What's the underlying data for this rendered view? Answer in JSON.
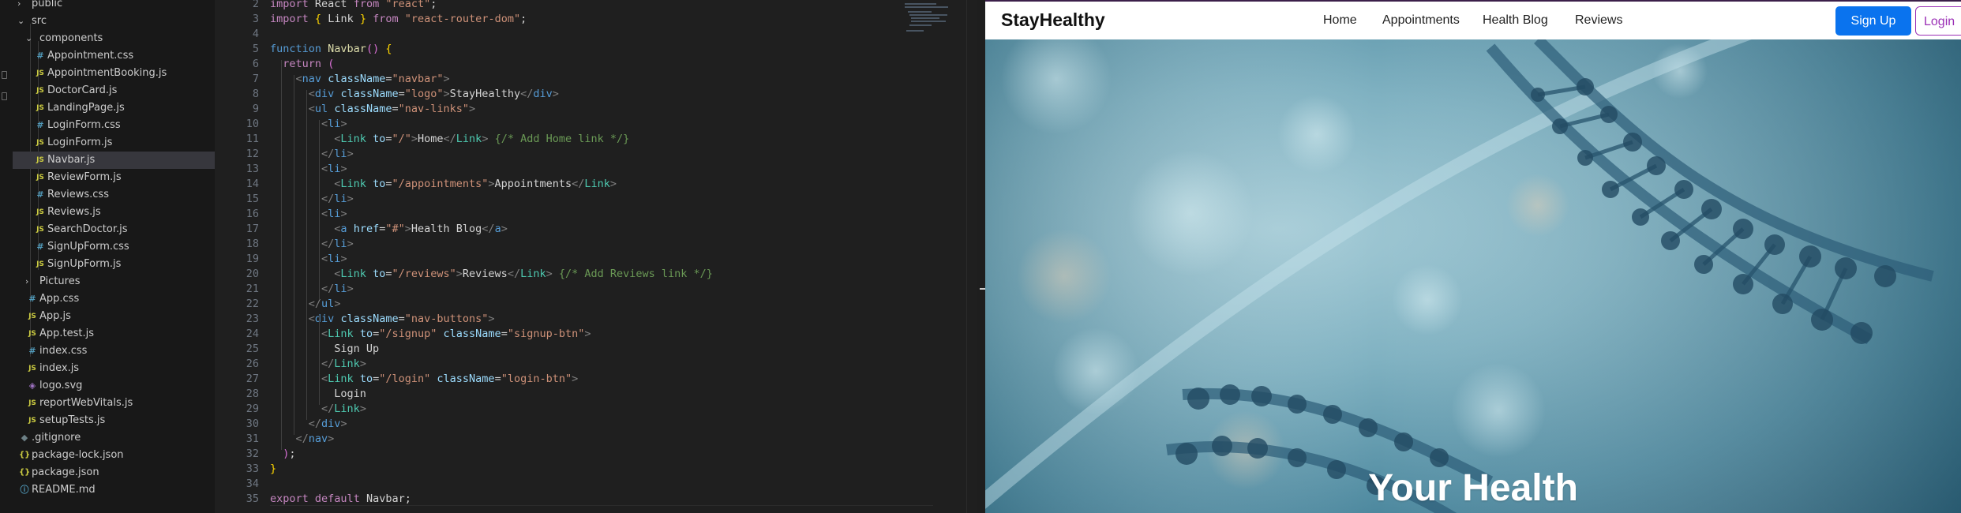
{
  "explorer": {
    "items": [
      {
        "label": "public",
        "type": "folder",
        "expanded": false
      },
      {
        "label": "src",
        "type": "folder",
        "expanded": true
      },
      {
        "label": "components",
        "type": "folder",
        "expanded": true
      },
      {
        "label": "Appointment.css",
        "type": "css"
      },
      {
        "label": "AppointmentBooking.js",
        "type": "js"
      },
      {
        "label": "DoctorCard.js",
        "type": "js"
      },
      {
        "label": "LandingPage.js",
        "type": "js"
      },
      {
        "label": "LoginForm.css",
        "type": "css"
      },
      {
        "label": "LoginForm.js",
        "type": "js"
      },
      {
        "label": "Navbar.js",
        "type": "js",
        "selected": true
      },
      {
        "label": "ReviewForm.js",
        "type": "js"
      },
      {
        "label": "Reviews.css",
        "type": "css"
      },
      {
        "label": "Reviews.js",
        "type": "js"
      },
      {
        "label": "SearchDoctor.js",
        "type": "js"
      },
      {
        "label": "SignUpForm.css",
        "type": "css"
      },
      {
        "label": "SignUpForm.js",
        "type": "js"
      },
      {
        "label": "Pictures",
        "type": "folder",
        "expanded": false
      },
      {
        "label": "App.css",
        "type": "css"
      },
      {
        "label": "App.js",
        "type": "js"
      },
      {
        "label": "App.test.js",
        "type": "js"
      },
      {
        "label": "index.css",
        "type": "css"
      },
      {
        "label": "index.js",
        "type": "js"
      },
      {
        "label": "logo.svg",
        "type": "svg"
      },
      {
        "label": "reportWebVitals.js",
        "type": "js"
      },
      {
        "label": "setupTests.js",
        "type": "js"
      },
      {
        "label": ".gitignore",
        "type": "git"
      },
      {
        "label": "package-lock.json",
        "type": "json"
      },
      {
        "label": "package.json",
        "type": "json"
      },
      {
        "label": "README.md",
        "type": "md"
      }
    ]
  },
  "editor": {
    "file": "Navbar.js",
    "lines": [
      {
        "n": "2",
        "text": "import React from \"react\";"
      },
      {
        "n": "3",
        "text": "import { Link } from \"react-router-dom\";"
      },
      {
        "n": "4",
        "text": ""
      },
      {
        "n": "5",
        "text": "function Navbar() {"
      },
      {
        "n": "6",
        "text": "  return ("
      },
      {
        "n": "7",
        "text": "    <nav className=\"navbar\">"
      },
      {
        "n": "8",
        "text": "      <div className=\"logo\">StayHealthy</div>"
      },
      {
        "n": "9",
        "text": "      <ul className=\"nav-links\">"
      },
      {
        "n": "10",
        "text": "        <li>"
      },
      {
        "n": "11",
        "text": "          <Link to=\"/\">Home</Link> {/* Add Home link */}"
      },
      {
        "n": "12",
        "text": "        </li>"
      },
      {
        "n": "13",
        "text": "        <li>"
      },
      {
        "n": "14",
        "text": "          <Link to=\"/appointments\">Appointments</Link>"
      },
      {
        "n": "15",
        "text": "        </li>"
      },
      {
        "n": "16",
        "text": "        <li>"
      },
      {
        "n": "17",
        "text": "          <a href=\"#\">Health Blog</a>"
      },
      {
        "n": "18",
        "text": "        </li>"
      },
      {
        "n": "19",
        "text": "        <li>"
      },
      {
        "n": "20",
        "text": "          <Link to=\"/reviews\">Reviews</Link> {/* Add Reviews link */}"
      },
      {
        "n": "21",
        "text": "        </li>"
      },
      {
        "n": "22",
        "text": "      </ul>"
      },
      {
        "n": "23",
        "text": "      <div className=\"nav-buttons\">"
      },
      {
        "n": "24",
        "text": "        <Link to=\"/signup\" className=\"signup-btn\">"
      },
      {
        "n": "25",
        "text": "          Sign Up"
      },
      {
        "n": "26",
        "text": "        </Link>"
      },
      {
        "n": "27",
        "text": "        <Link to=\"/login\" className=\"login-btn\">"
      },
      {
        "n": "28",
        "text": "          Login"
      },
      {
        "n": "29",
        "text": "        </Link>"
      },
      {
        "n": "30",
        "text": "      </div>"
      },
      {
        "n": "31",
        "text": "    </nav>"
      },
      {
        "n": "32",
        "text": "  );"
      },
      {
        "n": "33",
        "text": "}"
      },
      {
        "n": "34",
        "text": ""
      },
      {
        "n": "35",
        "text": "export default Navbar;"
      }
    ]
  },
  "browser": {
    "logo": "StayHealthy",
    "nav_links": [
      "Home",
      "Appointments",
      "Health Blog",
      "Reviews"
    ],
    "signup_label": "Sign Up",
    "login_label": "Login",
    "hero_title": "Your Health",
    "colors": {
      "signup_bg": "#0a73ee",
      "login_border": "#9b30b6",
      "hero": "#6a9fae"
    }
  }
}
